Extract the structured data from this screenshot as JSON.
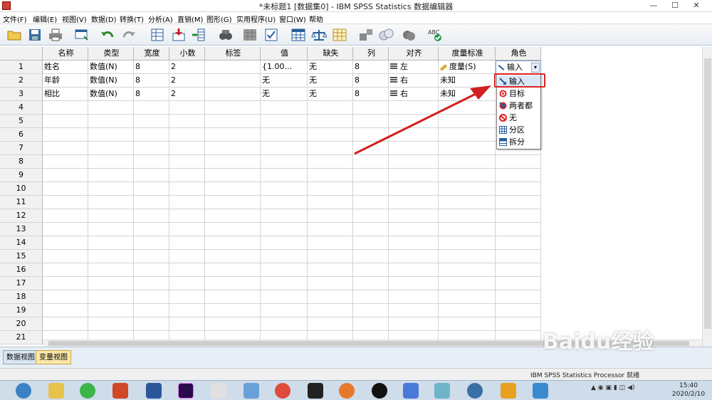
{
  "window": {
    "title": "*未标题1 [数据集0] - IBM SPSS Statistics 数据编辑器",
    "minimize": "—",
    "maximize": "☐",
    "close": "✕"
  },
  "menu": [
    "文件(F)",
    "编辑(E)",
    "视图(V)",
    "数据(D)",
    "转换(T)",
    "分析(A)",
    "直销(M)",
    "图形(G)",
    "实用程序(U)",
    "窗口(W)",
    "帮助"
  ],
  "toolbar": [
    "open-icon",
    "save-icon",
    "print-icon",
    "dialog-recall-icon",
    "undo-icon",
    "redo-icon",
    "goto-case-icon",
    "goto-variable-icon",
    "variables-icon",
    "find-icon",
    "insert-cases-icon",
    "insert-variable-icon",
    "split-file-icon",
    "weight-cases-icon",
    "select-cases-icon",
    "value-labels-icon",
    "use-sets-icon",
    "show-all-variables-icon",
    "spell-check-icon"
  ],
  "grid": {
    "headers": [
      "名称",
      "类型",
      "宽度",
      "小数",
      "标签",
      "值",
      "缺失",
      "列",
      "对齐",
      "度量标准",
      "角色"
    ],
    "rows": [
      {
        "num": "1",
        "name": "姓名",
        "type": "数值(N)",
        "width": "8",
        "decimals": "2",
        "label": "",
        "values": "{1.00...",
        "missing": "无",
        "columns": "8",
        "align": "左",
        "measure": "度量(S)",
        "role": "输入"
      },
      {
        "num": "2",
        "name": "年龄",
        "type": "数值(N)",
        "width": "8",
        "decimals": "2",
        "label": "",
        "values": "无",
        "missing": "无",
        "columns": "8",
        "align": "右",
        "measure": "未知",
        "role": ""
      },
      {
        "num": "3",
        "name": "相比",
        "type": "数值(N)",
        "width": "8",
        "decimals": "2",
        "label": "",
        "values": "无",
        "missing": "无",
        "columns": "8",
        "align": "右",
        "measure": "未知",
        "role": ""
      }
    ],
    "empty_rows": [
      "4",
      "5",
      "6",
      "7",
      "8",
      "9",
      "10",
      "11",
      "12",
      "13",
      "14",
      "15",
      "16",
      "17",
      "18",
      "19",
      "20",
      "21"
    ]
  },
  "role_dropdown": {
    "items": [
      {
        "label": "输入",
        "icon": "input-arrow-icon"
      },
      {
        "label": "目标",
        "icon": "target-icon"
      },
      {
        "label": "两者都",
        "icon": "both-icon"
      },
      {
        "label": "无",
        "icon": "none-icon"
      },
      {
        "label": "分区",
        "icon": "partition-icon"
      },
      {
        "label": "拆分",
        "icon": "split-icon"
      }
    ]
  },
  "tabs": {
    "data_view": "数据视图",
    "variable_view": "变量视图"
  },
  "status": {
    "processor": "IBM SPSS Statistics Processor 就绪"
  },
  "taskbar": {
    "time": "15:40",
    "date": "2020/2/10"
  },
  "watermark": "Baidu经验",
  "colors": {
    "highlight": "#d22222",
    "active_tab": "#fbe7a8",
    "selected_item": "#d9e7f7"
  }
}
